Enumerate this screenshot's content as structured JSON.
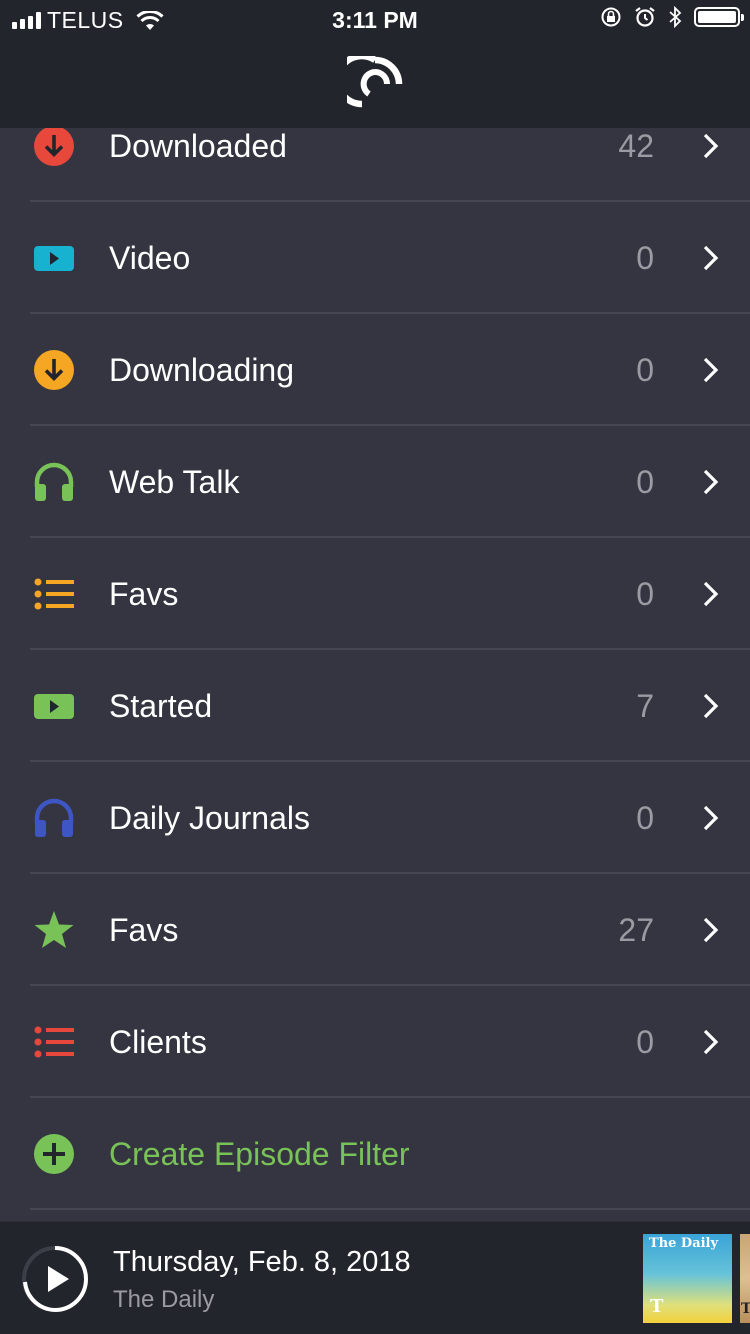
{
  "status_bar": {
    "carrier": "TELUS",
    "time": "3:11 PM"
  },
  "app": {
    "logo_icon": "pocket-casts-logo-icon"
  },
  "colors": {
    "background": "#353541",
    "header": "#22252b",
    "divider": "#464651",
    "count_text": "#9b9ba3",
    "accent_green": "#78c257"
  },
  "filters": [
    {
      "label": "Downloaded",
      "count": "42",
      "icon": "download-circle-icon",
      "icon_color": "#e8483c"
    },
    {
      "label": "Video",
      "count": "0",
      "icon": "video-play-icon",
      "icon_color": "#17b2d0"
    },
    {
      "label": "Downloading",
      "count": "0",
      "icon": "download-circle-icon",
      "icon_color": "#f5a623"
    },
    {
      "label": "Web Talk",
      "count": "0",
      "icon": "headphones-icon",
      "icon_color": "#78c257"
    },
    {
      "label": "Favs",
      "count": "0",
      "icon": "list-icon",
      "icon_color": "#f5a623"
    },
    {
      "label": "Started",
      "count": "7",
      "icon": "video-play-icon",
      "icon_color": "#78c257"
    },
    {
      "label": "Daily Journals",
      "count": "0",
      "icon": "headphones-icon",
      "icon_color": "#3e56c4"
    },
    {
      "label": "Favs",
      "count": "27",
      "icon": "star-icon",
      "icon_color": "#78c257"
    },
    {
      "label": "Clients",
      "count": "0",
      "icon": "list-icon",
      "icon_color": "#e8483c"
    }
  ],
  "create_filter": {
    "label": "Create Episode Filter",
    "icon": "plus-circle-icon",
    "icon_color": "#78c257"
  },
  "player": {
    "episode_title": "Thursday, Feb. 8, 2018",
    "podcast_name": "The Daily",
    "artwork_text": "The Daily",
    "artwork_logo": "T",
    "next_artwork_text": "T"
  }
}
